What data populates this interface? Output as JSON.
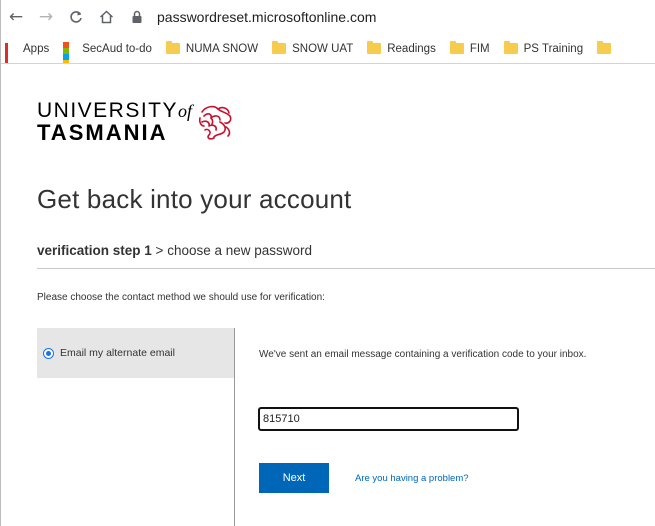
{
  "browser": {
    "nav": {
      "back_icon": "←",
      "forward_icon": "→",
      "reload_icon": "C",
      "home_icon": "⌂"
    },
    "url": "passwordreset.microsoftonline.com",
    "bookmarks": [
      {
        "label": "Apps",
        "icon": "apps-grid"
      },
      {
        "label": "SecAud to-do",
        "icon": "windows-logo"
      },
      {
        "label": "NUMA SNOW",
        "icon": "folder"
      },
      {
        "label": "SNOW UAT",
        "icon": "folder"
      },
      {
        "label": "Readings",
        "icon": "folder"
      },
      {
        "label": "FIM",
        "icon": "folder"
      },
      {
        "label": "PS Training",
        "icon": "folder"
      }
    ]
  },
  "logo": {
    "line1": "UNIVERSITY",
    "of": "of",
    "line2": "TASMANIA"
  },
  "page": {
    "heading": "Get back into your account",
    "step_active": "verification step 1",
    "step_sep": " > ",
    "step_next": "choose a new password",
    "instruction": "Please choose the contact method we should use for verification:",
    "method_label": "Email my alternate email",
    "sent_message": "We've sent an email message containing a verification code to your inbox.",
    "code_value": "815710",
    "next_label": "Next",
    "problem_link": "Are you having a problem?"
  },
  "colors": {
    "accent": "#0067b8",
    "folder": "#f7cb4d",
    "method_bg": "#e6e6e6"
  }
}
